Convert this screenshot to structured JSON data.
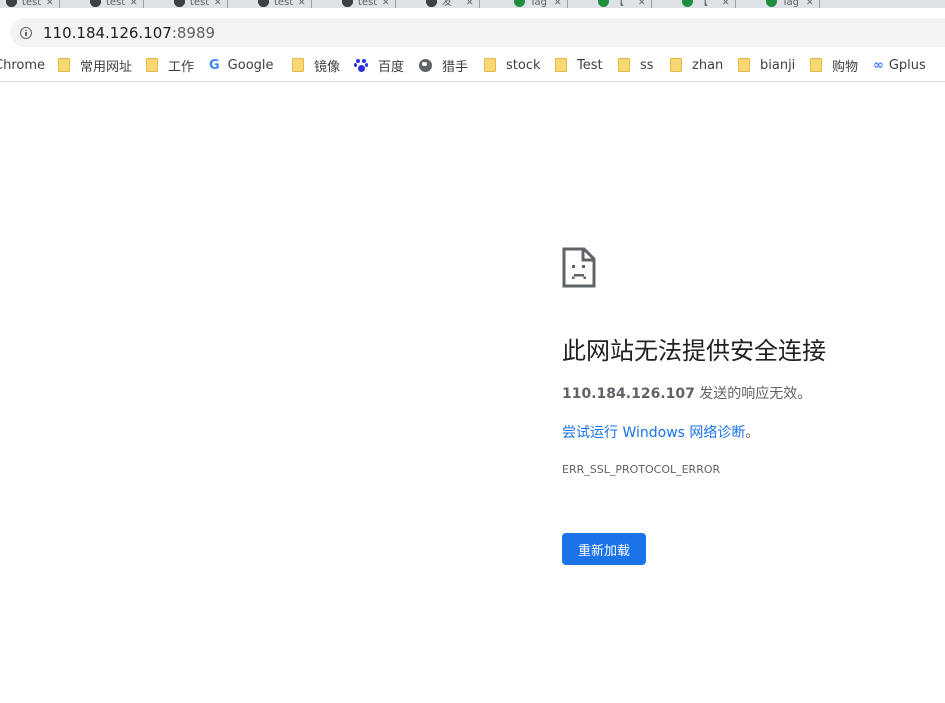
{
  "tabs": [
    {
      "title": "test",
      "icon": "github-icon"
    },
    {
      "title": "test",
      "icon": "github-icon"
    },
    {
      "title": "test",
      "icon": "github-icon"
    },
    {
      "title": "test",
      "icon": "github-icon"
    },
    {
      "title": "test",
      "icon": "github-icon"
    },
    {
      "title": "发",
      "icon": "green-dot-icon"
    },
    {
      "title": "Tag",
      "icon": "green-dot-icon"
    },
    {
      "title": "【",
      "icon": "green-dot-icon"
    },
    {
      "title": "【",
      "icon": "green-dot-icon"
    },
    {
      "title": "Tag",
      "icon": "green-dot-icon"
    }
  ],
  "omnibox": {
    "host": "110.184.126.107",
    "port": ":8989"
  },
  "bookmarks": [
    {
      "label": "Chrome",
      "icon": "none"
    },
    {
      "label": "常用网址",
      "icon": "folder-icon"
    },
    {
      "label": "工作",
      "icon": "folder-icon"
    },
    {
      "label": "Google",
      "icon": "google-icon"
    },
    {
      "label": "镜像",
      "icon": "folder-icon"
    },
    {
      "label": "百度",
      "icon": "baidu-icon"
    },
    {
      "label": "猎手",
      "icon": "globe-icon"
    },
    {
      "label": "stock",
      "icon": "folder-icon"
    },
    {
      "label": "Test",
      "icon": "folder-icon"
    },
    {
      "label": "ss",
      "icon": "folder-icon"
    },
    {
      "label": "zhan",
      "icon": "folder-icon"
    },
    {
      "label": "bianji",
      "icon": "folder-icon"
    },
    {
      "label": "购物",
      "icon": "folder-icon"
    },
    {
      "label": "Gplus",
      "icon": "gplus-icon"
    }
  ],
  "error": {
    "title": "此网站无法提供安全连接",
    "host": "110.184.126.107",
    "description_suffix": " 发送的响应无效。",
    "diagnostics_link": "尝试运行 Windows 网络诊断",
    "diagnostics_period": "。",
    "code": "ERR_SSL_PROTOCOL_ERROR",
    "reload_label": "重新加载"
  },
  "colors": {
    "accent": "#1a73e8",
    "text": "#202124",
    "secondary_text": "#5f6368"
  }
}
